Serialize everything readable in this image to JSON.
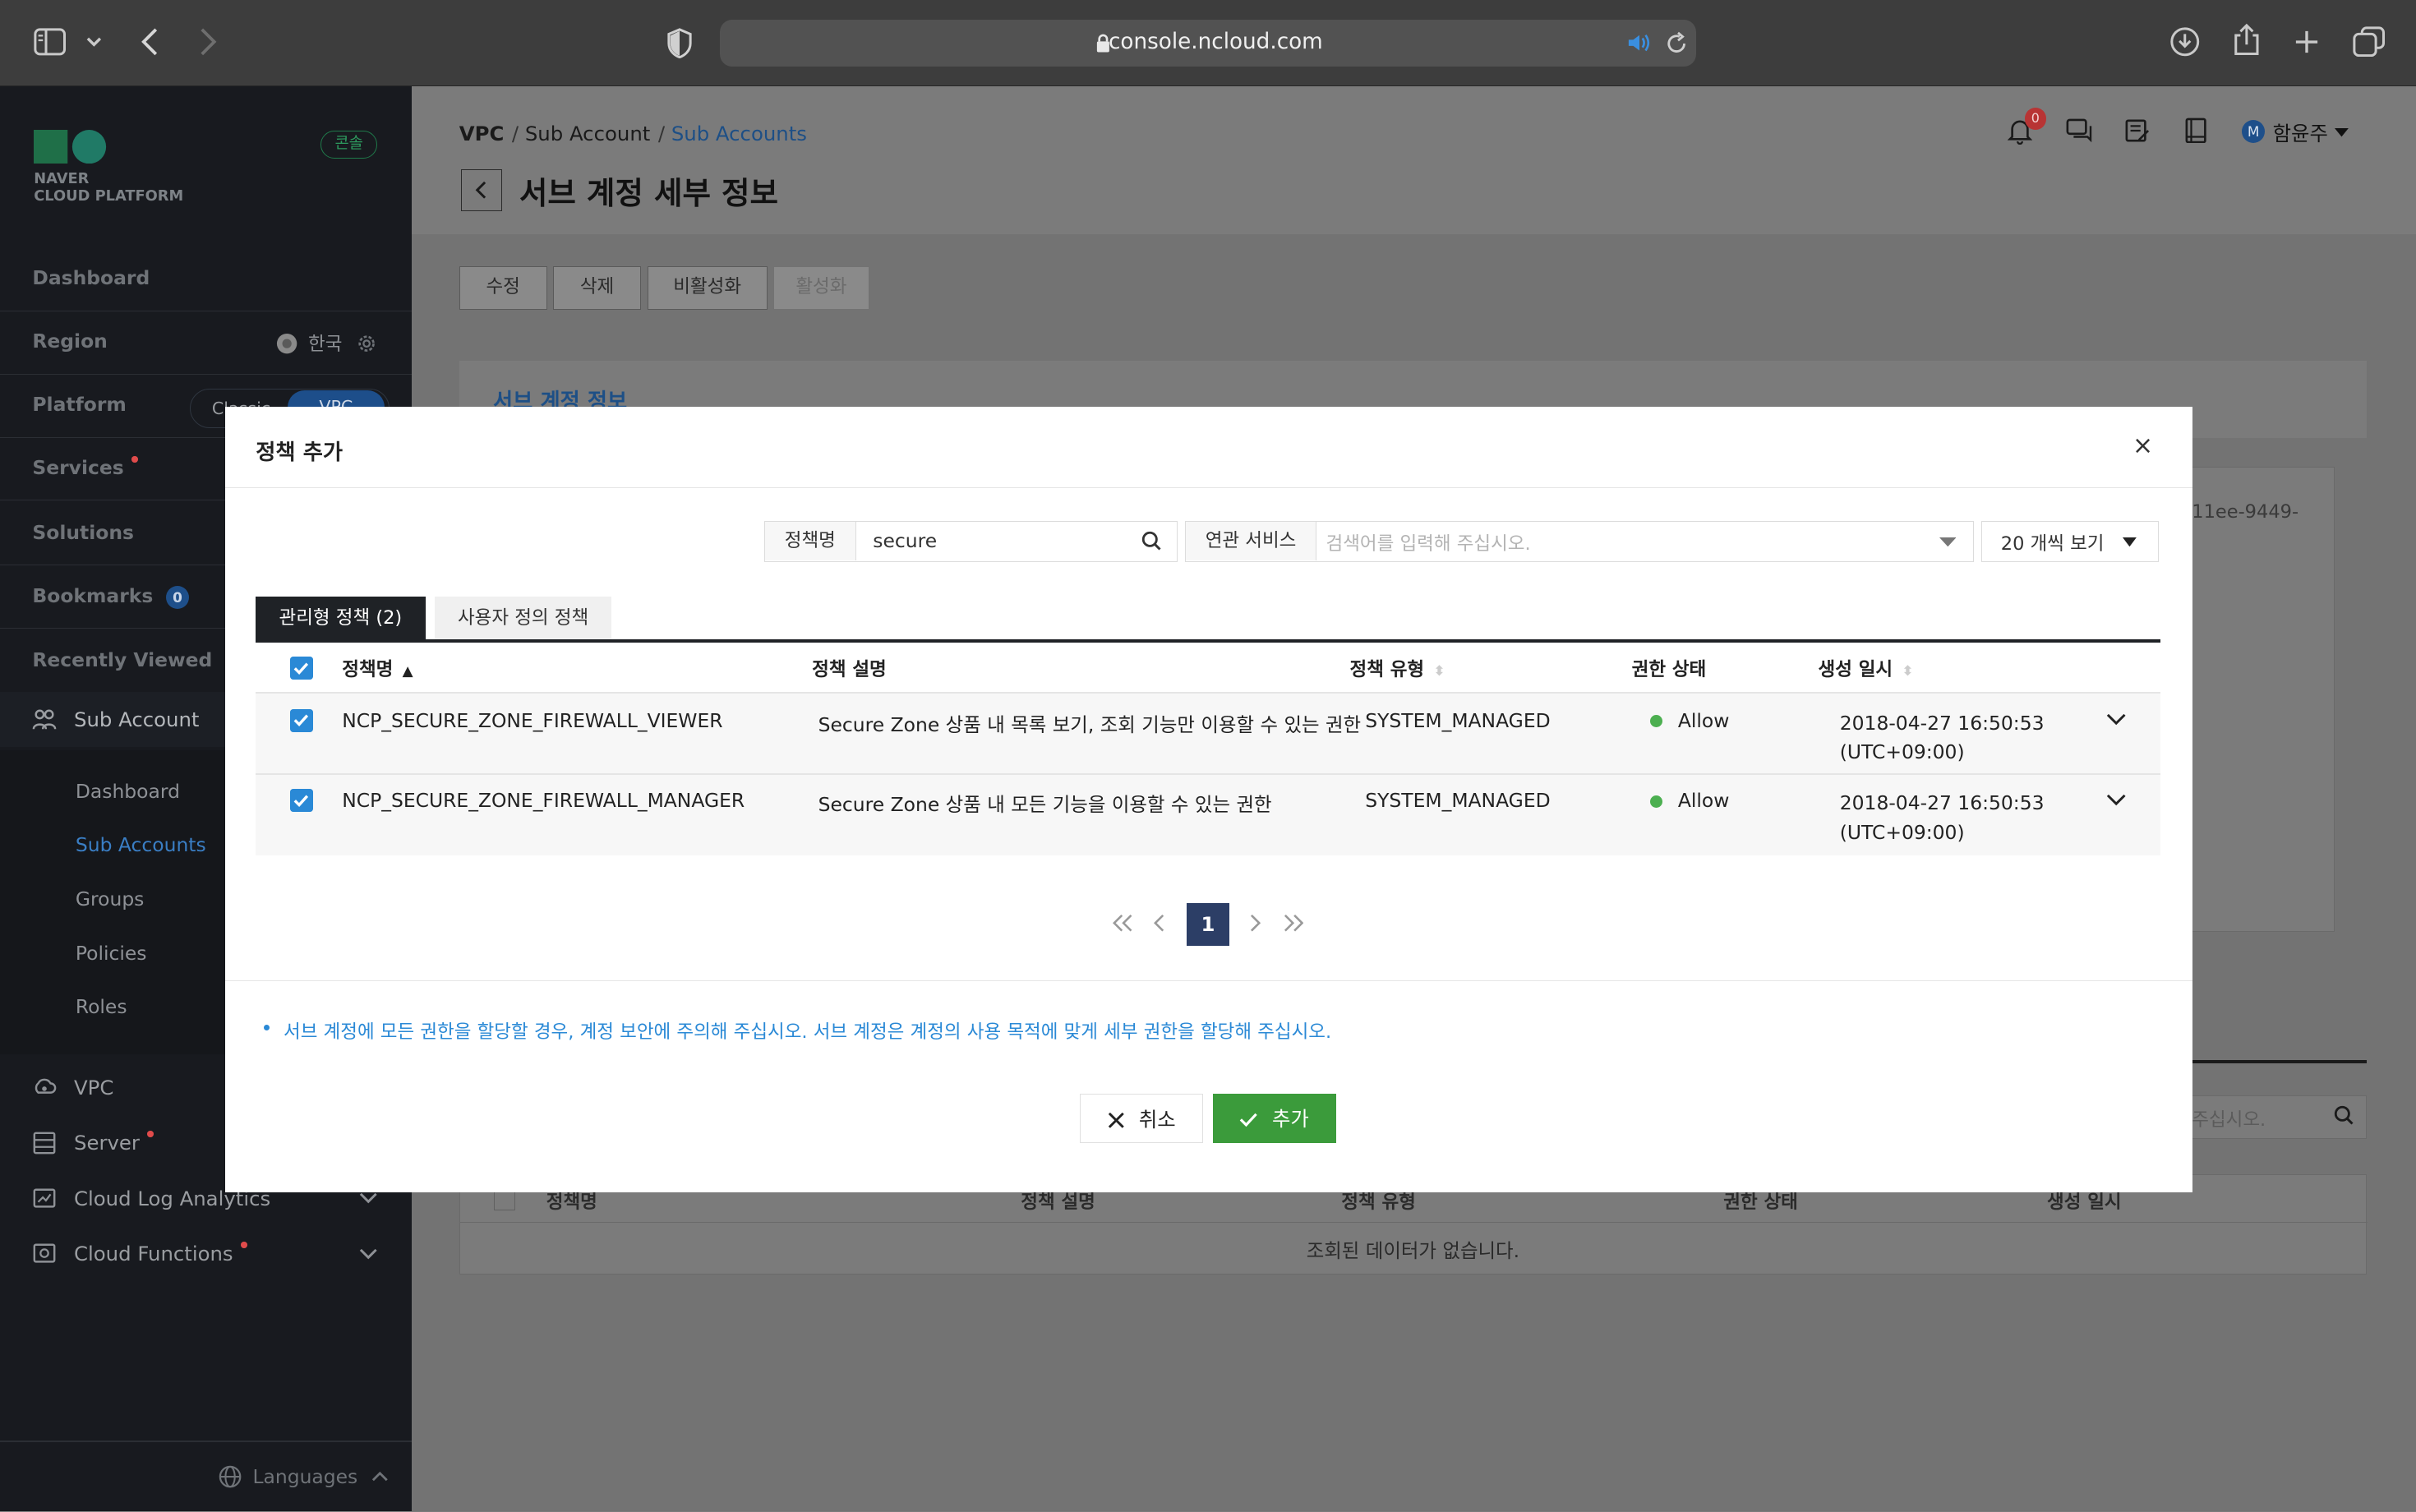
{
  "browser": {
    "url": "console.ncloud.com",
    "icons": [
      "sidebar-toggle-icon",
      "chevron-down-icon",
      "back-icon",
      "forward-icon",
      "shield-icon",
      "lock-icon",
      "speaker-icon",
      "reload-icon",
      "download-icon",
      "share-icon",
      "new-tab-icon",
      "tabs-icon"
    ]
  },
  "sidebar": {
    "logo_line1": "NAVER",
    "logo_line2": "CLOUD PLATFORM",
    "console_badge": "콘솔",
    "nav": [
      {
        "label": "Dashboard"
      },
      {
        "label": "Region",
        "value": "한국"
      },
      {
        "label": "Platform",
        "toggle_left": "Classic",
        "toggle_right": "VPC"
      },
      {
        "label": "Services"
      },
      {
        "label": "Solutions"
      },
      {
        "label": "Bookmarks",
        "badge": "0"
      },
      {
        "label": "Recently Viewed"
      }
    ],
    "sub_account": {
      "label": "Sub Account",
      "items": [
        "Dashboard",
        "Sub Accounts",
        "Groups",
        "Policies",
        "Roles"
      ],
      "active_index": 1
    },
    "services": [
      {
        "label": "VPC",
        "icon": "vpc-icon"
      },
      {
        "label": "Server",
        "icon": "server-icon",
        "new": true
      },
      {
        "label": "Cloud Log Analytics",
        "icon": "log-icon",
        "expand": true
      },
      {
        "label": "Cloud Functions",
        "icon": "functions-icon",
        "new": true,
        "expand": true
      }
    ],
    "languages": "Languages"
  },
  "page": {
    "breadcrumb": [
      "VPC",
      "Sub Account",
      "Sub Accounts"
    ],
    "title": "서브 계정 세부 정보",
    "notification_count": "0",
    "user_initial": "M",
    "user_name": "함윤주",
    "actions": [
      "수정",
      "삭제",
      "비활성화",
      "활성화"
    ],
    "section_title": "서브 계정 정보",
    "id_fragment": "11ee-9449-",
    "bottom_search_placeholder": "주십시오.",
    "bottom_table_headers": [
      "정책명",
      "정책 설명",
      "정책 유형",
      "권한 상태",
      "생성 일시"
    ],
    "empty_message": "조회된 데이터가 없습니다."
  },
  "modal": {
    "title": "정책 추가",
    "close": "×",
    "search": {
      "policy_label": "정책명",
      "policy_value": "secure",
      "service_label": "연관 서비스",
      "service_placeholder": "검색어를 입력해 주십시오.",
      "page_size": "20 개씩 보기"
    },
    "tabs": [
      {
        "label": "관리형 정책 (2)",
        "active": true
      },
      {
        "label": "사용자 정의 정책",
        "active": false
      }
    ],
    "columns": [
      "정책명",
      "정책 설명",
      "정책 유형",
      "권한 상태",
      "생성 일시"
    ],
    "rows": [
      {
        "checked": true,
        "name": "NCP_SECURE_ZONE_FIREWALL_VIEWER",
        "description": "Secure Zone 상품 내 목록 보기, 조회 기능만 이용할 수 있는 권한",
        "type": "SYSTEM_MANAGED",
        "status": "Allow",
        "created_date": "2018-04-27 16:50:53",
        "created_tz": "(UTC+09:00)"
      },
      {
        "checked": true,
        "name": "NCP_SECURE_ZONE_FIREWALL_MANAGER",
        "description": "Secure Zone 상품 내 모든 기능을 이용할 수 있는 권한",
        "type": "SYSTEM_MANAGED",
        "status": "Allow",
        "created_date": "2018-04-27 16:50:53",
        "created_tz": "(UTC+09:00)"
      }
    ],
    "pagination": {
      "current": "1"
    },
    "notice": "서브 계정에 모든 권한을 할당할 경우, 계정 보안에 주의해 주십시오. 서브 계정은 계정의 사용 목적에 맞게 세부 권한을 할당해 주십시오.",
    "cancel_label": "취소",
    "add_label": "추가"
  },
  "colors": {
    "accent_blue": "#2a89d6",
    "primary_green": "#3b9b3b",
    "page_button_navy": "#2c3e66",
    "allow_green": "#4caf50",
    "sidebar_bg": "#181a1f"
  }
}
